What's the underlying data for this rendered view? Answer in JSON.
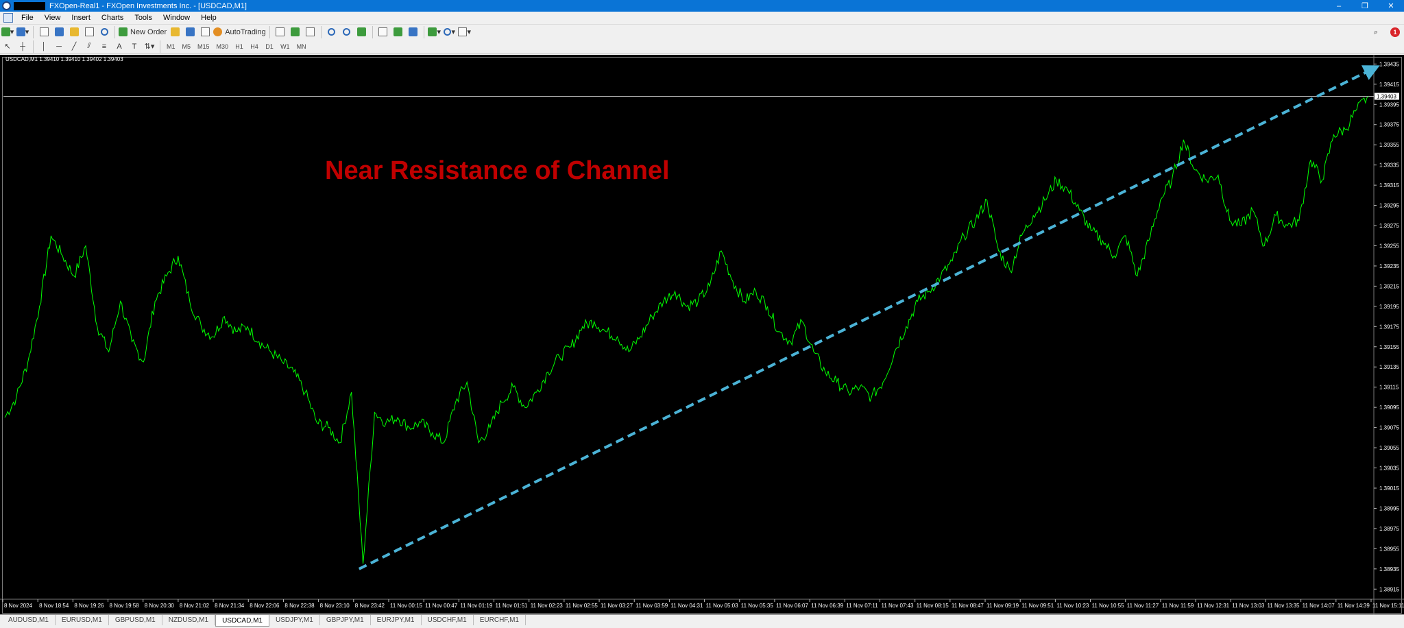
{
  "window": {
    "title": "FXOpen-Real1 - FXOpen Investments Inc. - [USDCAD,M1]",
    "controls": [
      "–",
      "❐",
      "✕"
    ]
  },
  "menu": [
    "File",
    "View",
    "Insert",
    "Charts",
    "Tools",
    "Window",
    "Help"
  ],
  "toolbar": {
    "new_order": "New Order",
    "auto_trading": "AutoTrading",
    "timeframes": [
      "M1",
      "M5",
      "M15",
      "M30",
      "H1",
      "H4",
      "D1",
      "W1",
      "MN"
    ],
    "notification_count": "1"
  },
  "chart": {
    "header": "USDCAD,M1  1.39410 1.39410 1.39402 1.39403",
    "annotation": "Near Resistance of Channel",
    "current_price": "1.39403",
    "colors": {
      "background": "#000000",
      "line": "#00ff00",
      "trendline": "#4bb3d6",
      "annotation": "#c00000",
      "axis_text": "#ffffff"
    }
  },
  "chart_data": {
    "type": "line",
    "symbol": "USDCAD",
    "timeframe": "M1",
    "ylim": [
      1.38905,
      1.3944
    ],
    "yticks": [
      "1.39435",
      "1.39415",
      "1.39395",
      "1.39375",
      "1.39355",
      "1.39335",
      "1.39315",
      "1.39295",
      "1.39275",
      "1.39255",
      "1.39235",
      "1.39215",
      "1.39195",
      "1.39175",
      "1.39155",
      "1.39135",
      "1.39115",
      "1.39095",
      "1.39075",
      "1.39055",
      "1.39035",
      "1.39015",
      "1.38995",
      "1.38975",
      "1.38955",
      "1.38935",
      "1.38915"
    ],
    "xticks": [
      "8 Nov 2024",
      "8 Nov 18:54",
      "8 Nov 19:26",
      "8 Nov 19:58",
      "8 Nov 20:30",
      "8 Nov 21:02",
      "8 Nov 21:34",
      "8 Nov 22:06",
      "8 Nov 22:38",
      "8 Nov 23:10",
      "8 Nov 23:42",
      "11 Nov 00:15",
      "11 Nov 00:47",
      "11 Nov 01:19",
      "11 Nov 01:51",
      "11 Nov 02:23",
      "11 Nov 02:55",
      "11 Nov 03:27",
      "11 Nov 03:59",
      "11 Nov 04:31",
      "11 Nov 05:03",
      "11 Nov 05:35",
      "11 Nov 06:07",
      "11 Nov 06:39",
      "11 Nov 07:11",
      "11 Nov 07:43",
      "11 Nov 08:15",
      "11 Nov 08:47",
      "11 Nov 09:19",
      "11 Nov 09:51",
      "11 Nov 10:23",
      "11 Nov 10:55",
      "11 Nov 11:27",
      "11 Nov 11:59",
      "11 Nov 12:31",
      "11 Nov 13:03",
      "11 Nov 13:35",
      "11 Nov 14:07",
      "11 Nov 14:39",
      "11 Nov 15:11"
    ],
    "series": [
      {
        "values": [
          1.39085,
          1.39105,
          1.3914,
          1.39195,
          1.39265,
          1.39245,
          1.39225,
          1.39255,
          1.39175,
          1.3915,
          1.392,
          1.3916,
          1.3914,
          1.392,
          1.39225,
          1.39245,
          1.392,
          1.39175,
          1.39165,
          1.39185,
          1.3917,
          1.39175,
          1.3916,
          1.3915,
          1.3914,
          1.3913,
          1.3911,
          1.3908,
          1.39075,
          1.3906,
          1.3911,
          1.3894,
          1.3909,
          1.3908,
          1.39085,
          1.39075,
          1.3908,
          1.3907,
          1.3906,
          1.391,
          1.3912,
          1.3906,
          1.39075,
          1.391,
          1.39115,
          1.39095,
          1.3911,
          1.3913,
          1.39145,
          1.39155,
          1.39175,
          1.3918,
          1.3917,
          1.39165,
          1.3915,
          1.39165,
          1.39185,
          1.392,
          1.3921,
          1.39195,
          1.392,
          1.39215,
          1.3925,
          1.3922,
          1.392,
          1.3921,
          1.39195,
          1.3917,
          1.3916,
          1.3918,
          1.3915,
          1.3913,
          1.3912,
          1.3911,
          1.39115,
          1.39105,
          1.3912,
          1.3915,
          1.39175,
          1.392,
          1.3921,
          1.39225,
          1.3924,
          1.39265,
          1.3928,
          1.393,
          1.3925,
          1.3923,
          1.39265,
          1.39285,
          1.393,
          1.3932,
          1.3931,
          1.3929,
          1.3927,
          1.3926,
          1.39245,
          1.39265,
          1.39225,
          1.3926,
          1.393,
          1.3932,
          1.3936,
          1.3933,
          1.3932,
          1.39325,
          1.3928,
          1.39275,
          1.3929,
          1.39255,
          1.39285,
          1.39275,
          1.3928,
          1.3934,
          1.3932,
          1.39365,
          1.3937,
          1.3939,
          1.39403
        ]
      }
    ],
    "trendline": {
      "from": {
        "x": "8 Nov 23:42",
        "y": 1.38935
      },
      "to": {
        "x": "11 Nov 15:11",
        "y": 1.3943
      },
      "style": "dashed",
      "arrow": true
    }
  },
  "tabs": [
    {
      "label": "AUDUSD,M1",
      "active": false
    },
    {
      "label": "EURUSD,M1",
      "active": false
    },
    {
      "label": "GBPUSD,M1",
      "active": false
    },
    {
      "label": "NZDUSD,M1",
      "active": false
    },
    {
      "label": "USDCAD,M1",
      "active": true
    },
    {
      "label": "USDJPY,M1",
      "active": false
    },
    {
      "label": "GBPJPY,M1",
      "active": false
    },
    {
      "label": "EURJPY,M1",
      "active": false
    },
    {
      "label": "USDCHF,M1",
      "active": false
    },
    {
      "label": "EURCHF,M1",
      "active": false
    }
  ]
}
